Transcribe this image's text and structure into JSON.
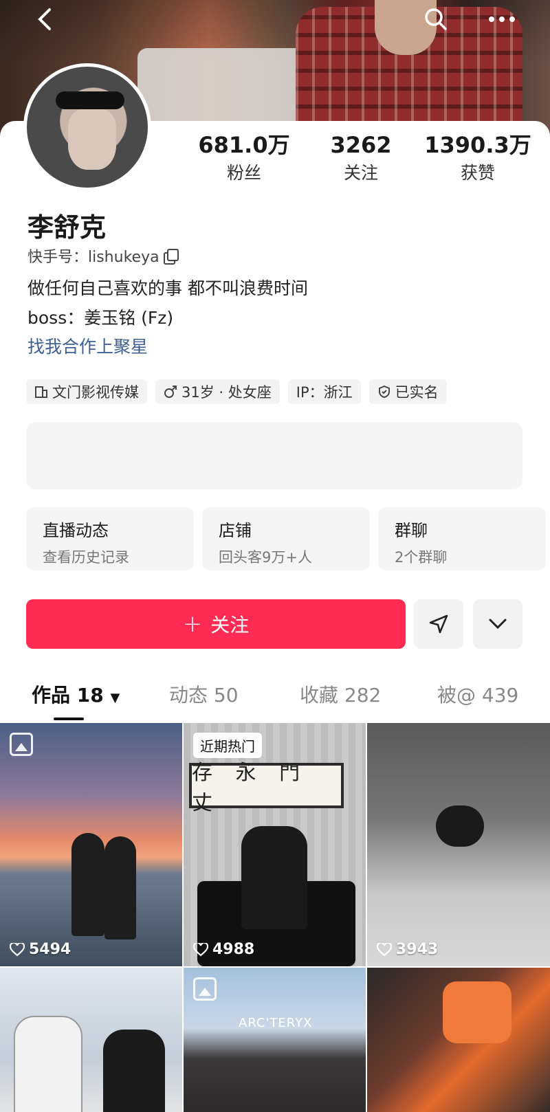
{
  "header": {
    "back_icon": "chevron-left-icon",
    "search_icon": "search-icon",
    "more_icon": "more-horizontal-icon"
  },
  "profile": {
    "stats": [
      {
        "value": "681.0万",
        "label": "粉丝"
      },
      {
        "value": "3262",
        "label": "关注"
      },
      {
        "value": "1390.3万",
        "label": "获赞"
      }
    ],
    "name": "李舒克",
    "account_id": "快手号：lishukeya",
    "bio_lines": [
      "做任何自己喜欢的事 都不叫浪费时间",
      "boss：姜玉铭 (Fz)"
    ],
    "link": "找我合作上聚星",
    "tags": [
      {
        "icon": "building-icon",
        "label": "文门影视传媒"
      },
      {
        "icon": "male-icon",
        "label": "31岁 · 处女座"
      },
      {
        "icon": "",
        "label": "IP：浙江"
      },
      {
        "icon": "shield-check-icon",
        "label": "已实名"
      }
    ]
  },
  "features": [
    {
      "title": "直播动态",
      "sub": "查看历史记录"
    },
    {
      "title": "店铺",
      "sub": "回头客9万+人"
    },
    {
      "title": "群聊",
      "sub": "2个群聊"
    }
  ],
  "actions": {
    "follow_label": "关注",
    "share_icon": "send-icon",
    "more_icon": "chevron-down-icon"
  },
  "tabs": [
    {
      "label": "作品",
      "count": "18",
      "active": true
    },
    {
      "label": "动态",
      "count": "50"
    },
    {
      "label": "收藏",
      "count": "282"
    },
    {
      "label": "被@",
      "count": "439"
    }
  ],
  "grid": [
    {
      "likes": "5494",
      "badge": "",
      "gallery": true
    },
    {
      "likes": "4988",
      "badge": "近期热门",
      "plaque": "存 永 門 丈"
    },
    {
      "likes": "3943",
      "badge": ""
    },
    {
      "likes": "",
      "badge": ""
    },
    {
      "likes": "",
      "badge": "",
      "gallery": true,
      "logo": "ARC'TERYX"
    },
    {
      "likes": "",
      "badge": ""
    }
  ],
  "colors": {
    "accent": "#fe2c55",
    "link": "#3d5f95"
  }
}
